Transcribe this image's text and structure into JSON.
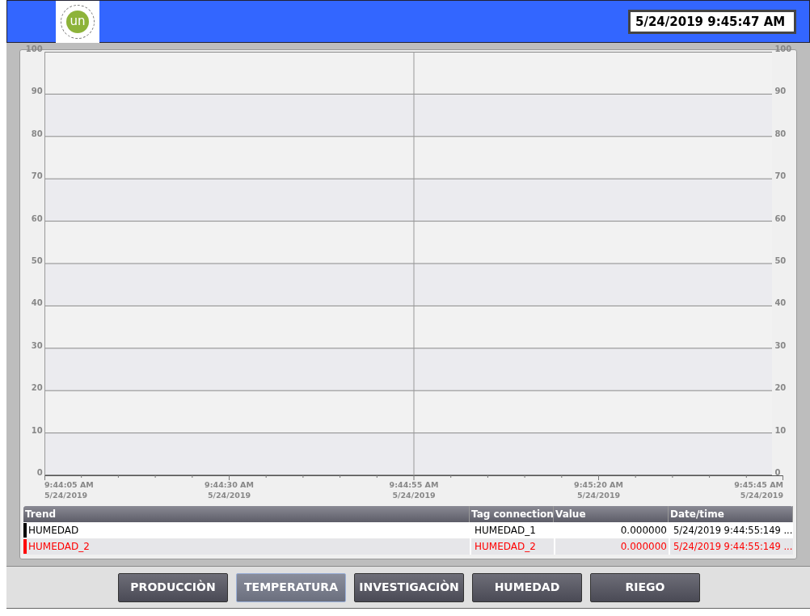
{
  "header": {
    "logo_text": "un",
    "clock": "5/24/2019 9:45:47 AM"
  },
  "trend": {
    "left_axis_labels": [
      "100",
      "90",
      "80",
      "70",
      "60",
      "50",
      "40",
      "30",
      "20",
      "10",
      "0"
    ],
    "right_axis_labels": [
      "100",
      "90",
      "80",
      "70",
      "60",
      "50",
      "40",
      "30",
      "20",
      "10",
      "0"
    ],
    "time_axis_labels": [
      {
        "time": "9:44:05 AM",
        "date": "5/24/2019"
      },
      {
        "time": "9:44:30 AM",
        "date": "5/24/2019"
      },
      {
        "time": "9:44:55 AM",
        "date": "5/24/2019"
      },
      {
        "time": "9:45:20 AM",
        "date": "5/24/2019"
      },
      {
        "time": "9:45:45 AM",
        "date": "5/24/2019"
      }
    ],
    "table": {
      "columns": [
        "Trend",
        "Tag connection",
        "Value",
        "Date/time"
      ],
      "rows": [
        {
          "trend": "HUMEDAD",
          "tag": "HUMEDAD_1",
          "value": "0.000000",
          "datetime": "5/24/2019 9:44:55:149 ...",
          "color": "#000000"
        },
        {
          "trend": "HUMEDAD_2",
          "tag": "HUMEDAD_2",
          "value": "0.000000",
          "datetime": "5/24/2019 9:44:55:149 ...",
          "color": "#ff0000"
        }
      ]
    }
  },
  "nav": [
    {
      "label": "PRODUCCIÒN",
      "selected": false
    },
    {
      "label": "TEMPERATURA",
      "selected": true
    },
    {
      "label": "INVESTIGACIÒN",
      "selected": false
    },
    {
      "label": "HUMEDAD",
      "selected": false
    },
    {
      "label": "RIEGO",
      "selected": false
    }
  ]
}
